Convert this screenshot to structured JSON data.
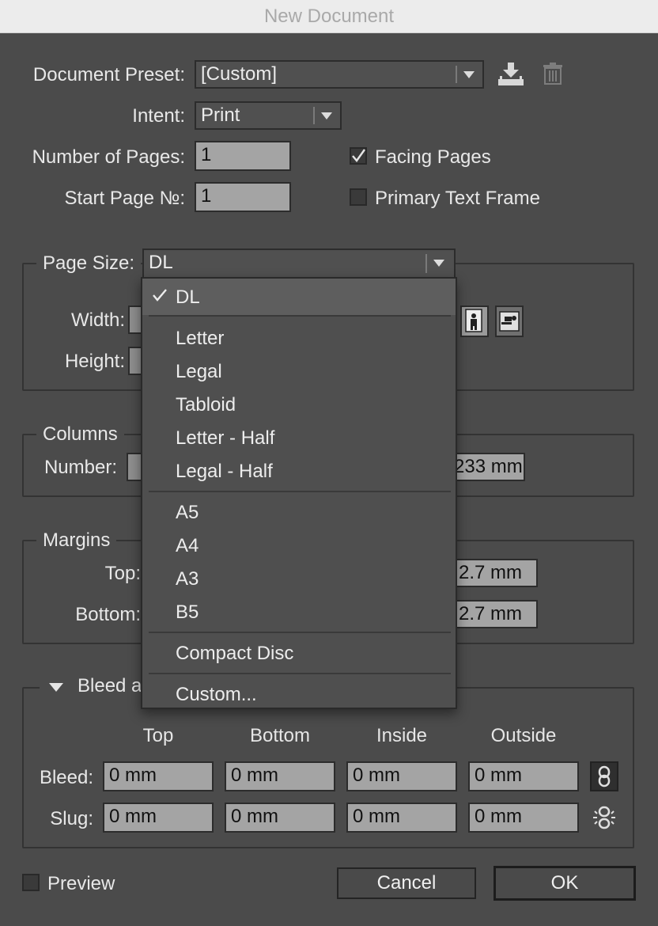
{
  "window": {
    "title": "New Document"
  },
  "preset": {
    "label": "Document Preset:",
    "value": "[Custom]"
  },
  "intent": {
    "label": "Intent:",
    "value": "Print"
  },
  "pages": {
    "label": "Number of Pages:",
    "value": "1"
  },
  "start_page": {
    "label": "Start Page №:",
    "value": "1"
  },
  "facing_pages": {
    "label": "Facing Pages",
    "checked": true
  },
  "primary_text_frame": {
    "label": "Primary Text Frame",
    "checked": false
  },
  "page_size": {
    "label": "Page Size:",
    "value": "DL",
    "width_label": "Width:",
    "height_label": "Height:"
  },
  "columns": {
    "title": "Columns",
    "number_label": "Number:",
    "gutter_partial": "233 mm"
  },
  "margins": {
    "title": "Margins",
    "top_label": "Top:",
    "bottom_label": "Bottom:",
    "inside_partial": "2.7 mm",
    "outside_partial": "2.7 mm"
  },
  "bleed": {
    "title_partial": "Bleed a",
    "headers": [
      "Top",
      "Bottom",
      "Inside",
      "Outside"
    ],
    "bleed_label": "Bleed:",
    "slug_label": "Slug:",
    "bleed_values": [
      "0 mm",
      "0 mm",
      "0 mm",
      "0 mm"
    ],
    "slug_values": [
      "0 mm",
      "0 mm",
      "0 mm",
      "0 mm"
    ]
  },
  "preview": {
    "label": "Preview",
    "checked": false
  },
  "buttons": {
    "cancel": "Cancel",
    "ok": "OK"
  },
  "menu": {
    "selected": "DL",
    "items": [
      "DL",
      "Letter",
      "Legal",
      "Tabloid",
      "Letter - Half",
      "Legal - Half",
      "A5",
      "A4",
      "A3",
      "B5",
      "Compact Disc",
      "Custom..."
    ]
  },
  "icons": {
    "save_preset": "save-preset-icon",
    "delete_preset": "trash-icon",
    "chain": "chain-link-icon",
    "chain_broken": "chain-broken-icon"
  },
  "colors": {
    "background": "#4b4b4b",
    "field": "#a4a4a4",
    "titlebar": "#ececec"
  }
}
